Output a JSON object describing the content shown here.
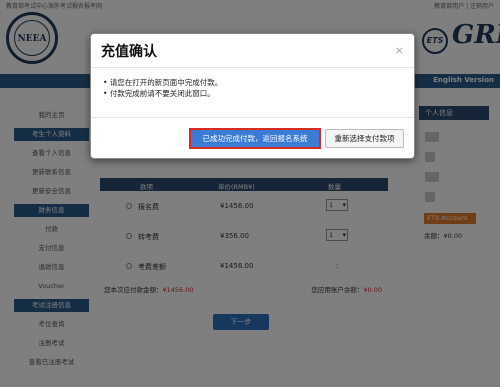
{
  "top_bar": {
    "left_text": "教育部考试中心海外考试报名报考网",
    "right_text": "教育部用户 | 注销用户"
  },
  "brand": {
    "logo_letters": "NEEA",
    "ets_text": "ETS",
    "gre_text": "GRE."
  },
  "nav": {
    "english_version": "English Version"
  },
  "sidebar": {
    "items": [
      {
        "label": "我的主页",
        "type": "link"
      },
      {
        "label": "考生个人资料",
        "type": "section"
      },
      {
        "label": "查看个人信息",
        "type": "link"
      },
      {
        "label": "更新联系信息",
        "type": "link"
      },
      {
        "label": "更新安全信息",
        "type": "link"
      },
      {
        "label": "财务信息",
        "type": "section"
      },
      {
        "label": "付款",
        "type": "link"
      },
      {
        "label": "支付信息",
        "type": "link"
      },
      {
        "label": "退款信息",
        "type": "link"
      },
      {
        "label": "Voucher",
        "type": "link"
      },
      {
        "label": "考试注册信息",
        "type": "section"
      },
      {
        "label": "考位查询",
        "type": "link"
      },
      {
        "label": "注册考试",
        "type": "link"
      },
      {
        "label": "查看已注册考试",
        "type": "link"
      }
    ]
  },
  "payment_table": {
    "headers": [
      "款项",
      "单价(RMB¥)",
      "数量"
    ],
    "rows": [
      {
        "name": "报名费",
        "price": "¥1456.00",
        "qty": "1"
      },
      {
        "name": "转考费",
        "price": "¥356.00",
        "qty": "1"
      },
      {
        "name": "考费差额",
        "price": "¥1456.00",
        "qty": ":"
      }
    ],
    "total_label": "您本次应付款金额：",
    "total_value": "¥1456.00",
    "balance_label": "您应用账户余额：",
    "balance_value": "¥0.00"
  },
  "next_button": "下一步",
  "info_panel": {
    "title": "个人信息",
    "ets_account": "ETS Account",
    "balance": "余额：¥0.00"
  },
  "modal": {
    "title": "充值确认",
    "close": "×",
    "lines": [
      "请您在打开的新页面中完成付款。",
      "付款完成前请不要关闭此窗口。"
    ],
    "primary_button": "已成功完成付款，返回报名系统",
    "secondary_button": "重新选择支付款项"
  },
  "colors": {
    "nav_blue": "#2c5d8a",
    "primary_button": "#3a7bd5",
    "highlight_border": "#d62d20",
    "ets_account": "#e27b2a"
  }
}
